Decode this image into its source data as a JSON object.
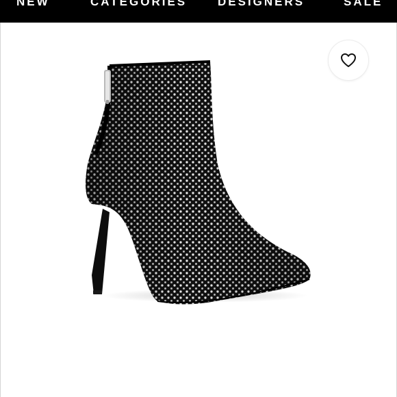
{
  "nav": {
    "items": [
      "NEW",
      "CATEGORIES",
      "DESIGNERS",
      "SALE"
    ],
    "background": "#000000",
    "text_color": "#ffffff"
  },
  "wishlist": {
    "icon": "heart-outline-icon"
  },
  "product": {
    "icon": "studded-stiletto-ankle-boot-image",
    "color": "#111111",
    "stud_color": "#d8d8d8"
  }
}
